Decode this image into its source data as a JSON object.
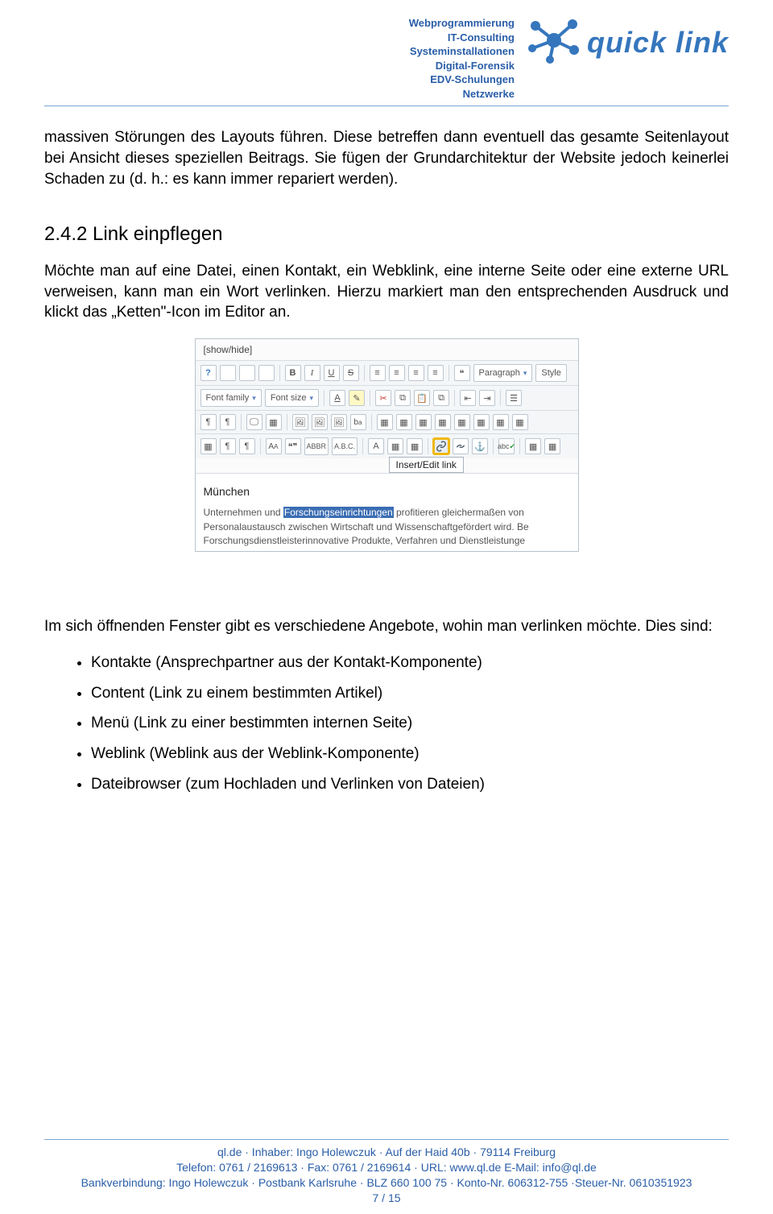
{
  "header": {
    "services": [
      "Webprogrammierung",
      "IT-Consulting",
      "Systeminstallationen",
      "Digital-Forensik",
      "EDV-Schulungen",
      "Netzwerke"
    ],
    "logo_text": "quick link"
  },
  "content": {
    "para1": "massiven Störungen des Layouts führen. Diese betreffen dann eventuell das gesamte Seitenlayout bei Ansicht dieses speziellen Beitrags. Sie fügen der Grundarchitektur der Website jedoch keinerlei Schaden zu (d. h.: es kann immer repariert werden).",
    "heading": "2.4.2 Link einpflegen",
    "para2": "Möchte man auf eine Datei, einen Kontakt, ein Webklink, eine interne Seite oder eine externe URL verweisen, kann man ein Wort verlinken. Hierzu markiert man den entsprechenden Ausdruck und klickt das „Ketten\"-Icon im Editor an.",
    "para3": "Im sich öffnenden Fenster gibt es verschiedene Angebote, wohin man verlinken möchte. Dies sind:",
    "bullets": [
      "Kontakte (Ansprechpartner aus der Kontakt-Komponente)",
      "Content (Link zu einem bestimmten Artikel)",
      "Menü (Link zu einer bestimmten internen Seite)",
      "Weblink (Weblink aus der Weblink-Komponente)",
      "Dateibrowser (zum Hochladen und Verlinken von Dateien)"
    ]
  },
  "figure": {
    "showhide": "[show/hide]",
    "row1": {
      "bold": "B",
      "italic": "I",
      "underline": "U",
      "strike": "S",
      "paragraph_label": "Paragraph",
      "style_label": "Style"
    },
    "row2": {
      "fontfamily": "Font family",
      "fontsize": "Font size"
    },
    "row4": {
      "abbr1": "ABBR",
      "abbr2": "A.B.C.",
      "acr": "A.B.C",
      "letter": "A"
    },
    "tooltip": "Insert/Edit link",
    "content_title": "München",
    "body_pre": "Unternehmen und ",
    "body_sel": "Forschungseinrichtungen",
    "body_post": " profitieren gleichermaßen von Personalaustausch zwischen Wirtschaft und Wissenschaftgefördert wird. Be Forschungsdienstleisterinnovative Produkte, Verfahren und Dienstleistunge"
  },
  "footer": {
    "line1": "ql.de · Inhaber: Ingo Holewczuk · Auf der Haid 40b · 79114 Freiburg",
    "line2": "Telefon: 0761 / 2169613 · Fax: 0761 / 2169614 · URL: www.ql.de E-Mail: info@ql.de",
    "line3": "Bankverbindung: Ingo Holewczuk · Postbank Karlsruhe · BLZ  660 100 75 · Konto-Nr.  606312-755 ·Steuer-Nr. 0610351923",
    "page": "7 / 15"
  }
}
